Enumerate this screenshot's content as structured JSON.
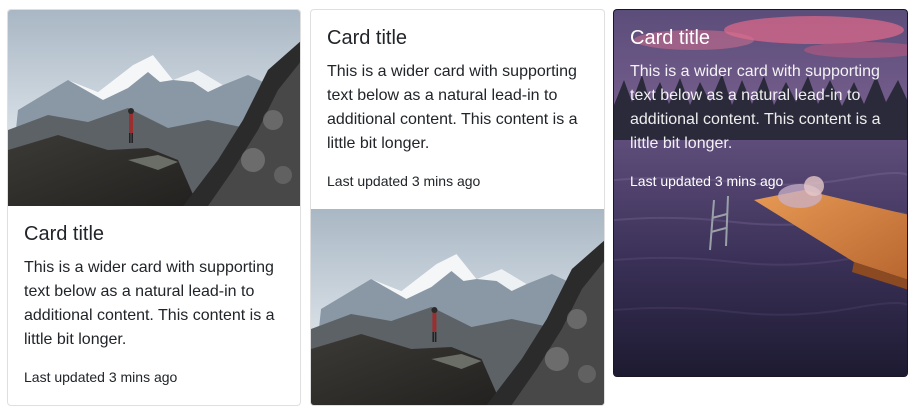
{
  "cards": [
    {
      "image_alt": "mountain-hiker-photo",
      "title": "Card title",
      "text": "This is a wider card with supporting text below as a natural lead-in to additional content. This content is a little bit longer.",
      "updated": "Last updated 3 mins ago"
    },
    {
      "image_alt": "mountain-hiker-photo",
      "title": "Card title",
      "text": "This is a wider card with supporting text below as a natural lead-in to additional content. This content is a little bit longer.",
      "updated": "Last updated 3 mins ago"
    },
    {
      "image_alt": "lake-dock-photo",
      "title": "Card title",
      "text": "This is a wider card with supporting text below as a natural lead-in to additional content. This content is a little bit longer.",
      "updated": "Last updated 3 mins ago"
    }
  ],
  "colors": {
    "card_border": "#dfdfdf",
    "text": "#212529",
    "overlay_text": "#ffffff"
  }
}
